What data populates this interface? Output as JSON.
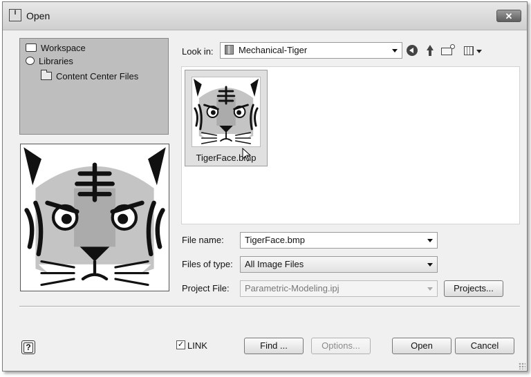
{
  "window": {
    "title": "Open",
    "app_icon_text": "I",
    "close_symbol": "✕"
  },
  "places": {
    "items": [
      {
        "label": "Workspace",
        "icon": "workspace-icon"
      },
      {
        "label": "Libraries",
        "icon": "libraries-icon"
      },
      {
        "label": "Content Center Files",
        "icon": "folder-icon"
      }
    ]
  },
  "lookin": {
    "label": "Look in:",
    "value": "Mechanical-Tiger"
  },
  "toolbar": {
    "icons": [
      "back-icon",
      "up-folder-icon",
      "new-folder-icon",
      "views-menu-icon"
    ]
  },
  "files": [
    {
      "name": "TigerFace.bmp",
      "selected": true
    }
  ],
  "form": {
    "file_name_label": "File name:",
    "file_name_value": "TigerFace.bmp",
    "files_of_type_label": "Files of type:",
    "files_of_type_value": "All Image Files",
    "project_file_label": "Project File:",
    "project_file_value": "Parametric-Modeling.ipj",
    "projects_button": "Projects..."
  },
  "footer": {
    "help_label": "?",
    "link_checked": true,
    "link_label": "LINK",
    "find_button": "Find ...",
    "options_button": "Options...",
    "open_button": "Open",
    "cancel_button": "Cancel"
  }
}
